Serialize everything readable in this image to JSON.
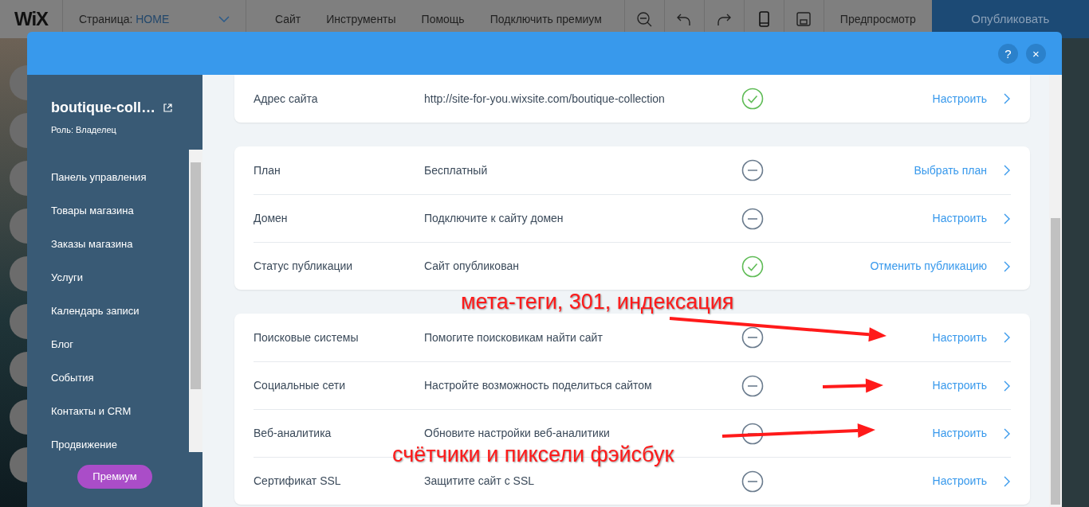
{
  "topbar": {
    "logo": "WiX",
    "page_label": "Страница:",
    "page_name": "HOME",
    "menu": [
      "Сайт",
      "Инструменты",
      "Помощь",
      "Подключить премиум"
    ],
    "tools": [
      {
        "kind": "zoom-out"
      },
      {
        "kind": "undo"
      },
      {
        "kind": "redo"
      },
      {
        "kind": "mobile"
      },
      {
        "kind": "save"
      }
    ],
    "preview": "Предпросмотр",
    "publish": "Опубликовать"
  },
  "dialog": {
    "help": "?",
    "close": "×"
  },
  "sidebar": {
    "site_name": "boutique-coll…",
    "role": "Роль: Владелец",
    "items": [
      "Панель управления",
      "Товары магазина",
      "Заказы магазина",
      "Услуги",
      "Календарь записи",
      "Блог",
      "События",
      "Контакты и CRM",
      "Продвижение"
    ],
    "premium": "Премиум"
  },
  "sections": [
    {
      "rows": [
        {
          "label": "Адрес сайта",
          "value": "http://site-for-you.wixsite.com/boutique-collection",
          "complete": true,
          "action": "Настроить"
        }
      ]
    },
    {
      "rows": [
        {
          "label": "План",
          "value": "Бесплатный",
          "complete": false,
          "action": "Выбрать план"
        },
        {
          "label": "Домен",
          "value": "Подключите к сайту домен",
          "complete": false,
          "action": "Настроить"
        },
        {
          "label": "Статус публикации",
          "value": "Сайт опубликован",
          "complete": true,
          "action": "Отменить публикацию"
        }
      ]
    },
    {
      "rows": [
        {
          "label": "Поисковые системы",
          "value": "Помогите поисковикам найти сайт",
          "complete": false,
          "action": "Настроить"
        },
        {
          "label": "Социальные сети",
          "value": "Настройте возможность поделиться сайтом",
          "complete": false,
          "action": "Настроить"
        },
        {
          "label": "Веб-аналитика",
          "value": "Обновите настройки веб-аналитики",
          "complete": false,
          "action": "Настроить"
        },
        {
          "label": "Сертификат SSL",
          "value": "Защитите сайт с SSL",
          "complete": false,
          "action": "Настроить"
        }
      ]
    }
  ],
  "annotations": [
    {
      "kind": "text",
      "text": "мета-теги, 301, индексация"
    },
    {
      "kind": "text",
      "text": "счётчики и пиксели фэйсбук"
    }
  ]
}
